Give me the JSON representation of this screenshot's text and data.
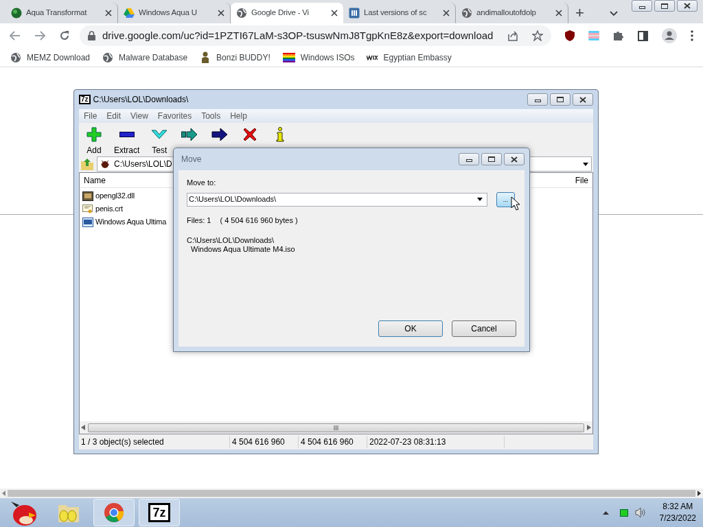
{
  "browser": {
    "tabs": [
      {
        "title": "Aqua Transformat",
        "kind": "globe",
        "selected": false
      },
      {
        "title": "Windows Aqua U",
        "kind": "drive",
        "selected": false
      },
      {
        "title": "Google Drive - Vi",
        "kind": "world",
        "selected": true
      },
      {
        "title": "Last versions of sc",
        "kind": "m",
        "selected": false
      },
      {
        "title": "andimalloutofdolp",
        "kind": "world",
        "selected": false
      }
    ],
    "new_tab": "+",
    "address": "drive.google.com/uc?id=1PZTI67LaM-s3OP-tsuswNmJ8TgpKnE8z&export=download",
    "bookmarks": [
      {
        "label": "MEMZ Download",
        "kind": "world"
      },
      {
        "label": "Malware Database",
        "kind": "world"
      },
      {
        "label": "Bonzi BUDDY!",
        "kind": "figure"
      },
      {
        "label": "Windows ISOs",
        "kind": "rainbow"
      },
      {
        "label": "Egyptian Embassy",
        "kind": "wix"
      }
    ]
  },
  "archiver": {
    "title": "C:\\Users\\LOL\\Downloads\\",
    "logo": "7z",
    "menu": [
      "File",
      "Edit",
      "View",
      "Favorites",
      "Tools",
      "Help"
    ],
    "toolbar": [
      {
        "kind": "add",
        "label": "Add"
      },
      {
        "kind": "extract",
        "label": "Extract"
      },
      {
        "kind": "test",
        "label": "Test"
      },
      {
        "kind": "copy"
      },
      {
        "kind": "move"
      },
      {
        "kind": "delete"
      },
      {
        "kind": "info"
      }
    ],
    "path": "C:\\Users\\LOL\\D",
    "columns": [
      "Name",
      "File"
    ],
    "files": [
      {
        "name": "opengl32.dll",
        "kind": "dll"
      },
      {
        "name": "penis.crt",
        "kind": "cert"
      },
      {
        "name": "Windows Aqua Ultima",
        "kind": "iso"
      }
    ],
    "status": [
      "1 / 3 object(s) selected",
      "4 504 616 960",
      "4 504 616 960",
      "2022-07-23 08:31:13"
    ]
  },
  "dialog": {
    "title": "Move",
    "label": "Move to:",
    "value": "C:\\Users\\LOL\\Downloads\\",
    "browse": "...",
    "files_count": "Files: 1",
    "files_size": "( 4 504 616 960 bytes )",
    "source_path": "C:\\Users\\LOL\\Downloads\\",
    "source_file": "Windows Aqua Ultimate M4.iso",
    "buttons": [
      "OK",
      "Cancel"
    ]
  },
  "taskbar": {
    "apps": [
      {
        "kind": "bird",
        "running": false
      },
      {
        "kind": "eggs",
        "running": false
      },
      {
        "kind": "chrome",
        "running": true
      },
      {
        "kind": "sevenzip",
        "label": "7z",
        "running": true
      }
    ],
    "time": "8:32 AM",
    "date": "7/23/2022"
  }
}
